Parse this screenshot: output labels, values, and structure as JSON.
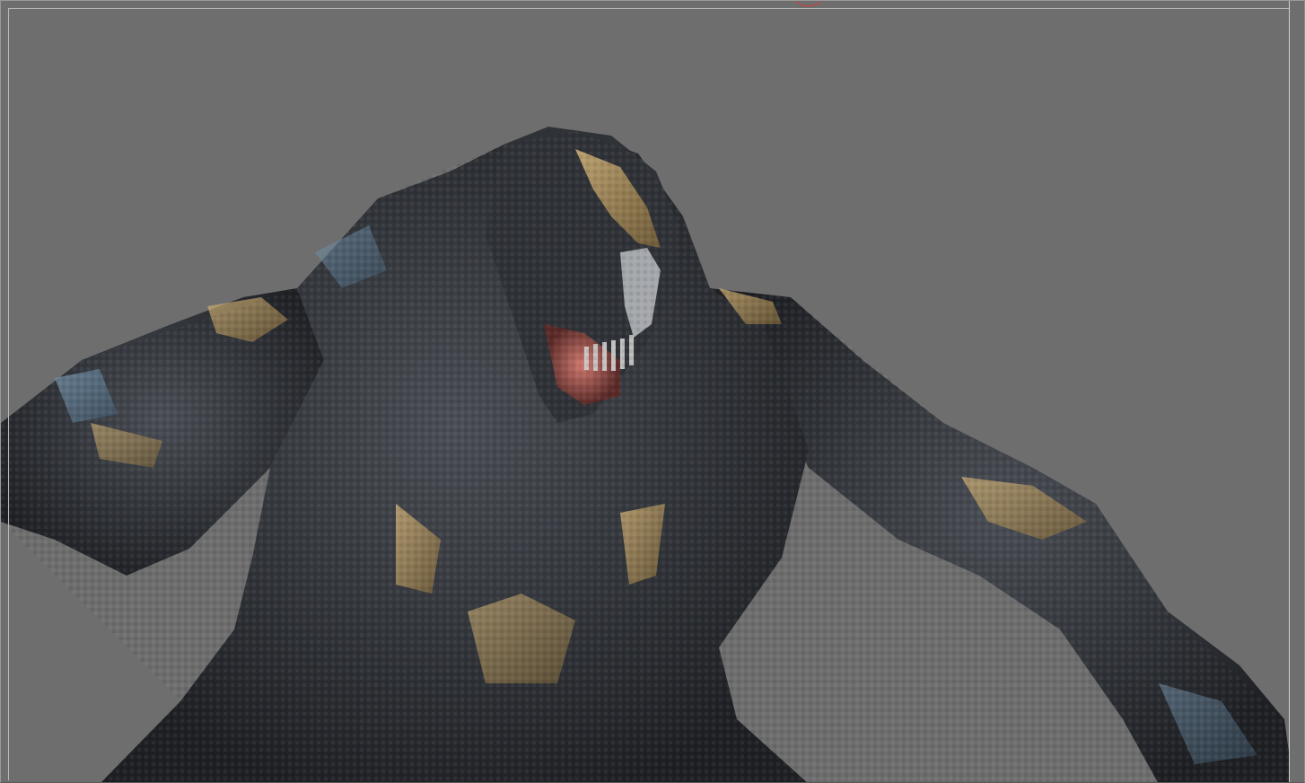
{
  "app": {
    "canvas_background": "#6e6e6e",
    "brush_cursor_color": "#d23a3a",
    "model_colors": {
      "skin_dark": "#2a2c30",
      "skin_mid": "#4a4e55",
      "highlight_gold": "#b89a62",
      "highlight_blue": "#5a7a95",
      "mouth_inner": "#a85a55",
      "teeth": "#cfcfcf"
    }
  }
}
